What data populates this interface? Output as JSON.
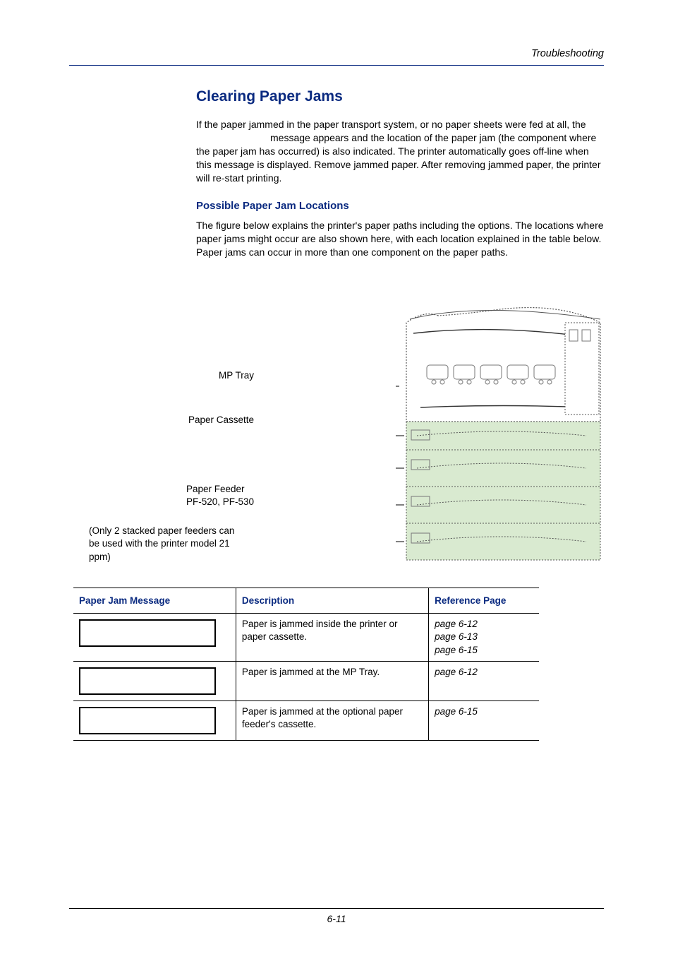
{
  "header": {
    "section_label": "Troubleshooting"
  },
  "heading": "Clearing Paper Jams",
  "intro_text": "If the paper jammed in the paper transport system, or no paper sheets were fed at all, the                            message appears and the location of the paper jam (the component where the paper jam has occurred) is also indicated. The printer automatically goes off-line when this message is displayed. Remove jammed paper. After removing jammed paper, the printer will re-start printing.",
  "subheading": "Possible Paper Jam Locations",
  "sub_text": "The figure below explains the printer's paper paths including the options. The locations where paper jams might occur are also shown here, with each location explained in the table below. Paper jams can occur in more than one component on the paper paths.",
  "figure": {
    "mp_tray": "MP Tray",
    "paper_cassette": "Paper Cassette",
    "paper_feeder_line1": "Paper Feeder",
    "paper_feeder_line2": "PF-520, PF-530",
    "note": "(Only 2 stacked paper feeders can be used with the printer model 21 ppm)"
  },
  "table": {
    "headers": {
      "msg": "Paper Jam Message",
      "desc": "Description",
      "ref": "Reference Page"
    },
    "rows": [
      {
        "msg": "",
        "desc": "Paper is jammed inside the printer or paper cassette.",
        "ref1": "page 6-12",
        "ref2": "page 6-13",
        "ref3": "page 6-15"
      },
      {
        "msg": "",
        "desc": "Paper is jammed at the MP Tray.",
        "ref1": "page 6-12"
      },
      {
        "msg": "",
        "desc": "Paper is jammed at the optional paper feeder's cassette.",
        "ref1": "page 6-15"
      }
    ]
  },
  "footer": {
    "page_num": "6-11"
  }
}
